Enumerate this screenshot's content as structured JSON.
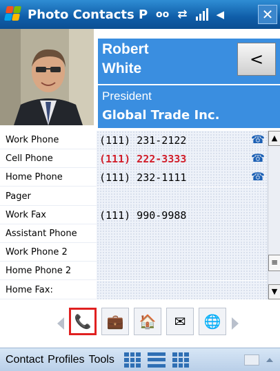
{
  "titlebar": {
    "app_title": "Photo Contacts P",
    "icons": [
      "voicemail-icon",
      "sync-icon",
      "signal-icon",
      "speaker-icon"
    ],
    "voicemail_glyph": "ᴏᴏ",
    "sync_glyph": "⇄",
    "signal_glyph": "📶",
    "speaker_glyph": "◀︎",
    "close_label": "✕"
  },
  "contact": {
    "first_name": "Robert",
    "last_name": "White",
    "job_title": "President",
    "company": "Global Trade Inc.",
    "back_label": "<"
  },
  "fields": [
    {
      "label": "Work Phone",
      "value": "(111) 231-2122",
      "has_phone_icon": true,
      "highlight": false
    },
    {
      "label": "Cell Phone",
      "value": "(111) 222-3333",
      "has_phone_icon": true,
      "highlight": true
    },
    {
      "label": "Home Phone",
      "value": "(111) 232-1111",
      "has_phone_icon": true,
      "highlight": false
    },
    {
      "label": "Pager",
      "value": "",
      "has_phone_icon": false,
      "highlight": false
    },
    {
      "label": "Work Fax",
      "value": "(111) 990-9988",
      "has_phone_icon": false,
      "highlight": false
    },
    {
      "label": "Assistant Phone",
      "value": "",
      "has_phone_icon": false,
      "highlight": false
    },
    {
      "label": "Work Phone 2",
      "value": "",
      "has_phone_icon": false,
      "highlight": false
    },
    {
      "label": "Home Phone 2",
      "value": "",
      "has_phone_icon": false,
      "highlight": false
    },
    {
      "label": "Home Fax:",
      "value": "",
      "has_phone_icon": false,
      "highlight": false
    }
  ],
  "scrollbar": {
    "up_glyph": "▲",
    "down_glyph": "▼",
    "thumb_glyph": "≡"
  },
  "toolbar": {
    "buttons": [
      {
        "name": "phone-profile-icon",
        "glyph": "📞",
        "selected": true
      },
      {
        "name": "briefcase-icon",
        "glyph": "💼",
        "selected": false
      },
      {
        "name": "home-icon",
        "glyph": "🏠",
        "selected": false
      },
      {
        "name": "email-icon",
        "glyph": "✉",
        "selected": false
      },
      {
        "name": "globe-icon",
        "glyph": "🌐",
        "selected": false
      }
    ]
  },
  "menubar": {
    "items": [
      "Contact",
      "Profiles",
      "Tools"
    ],
    "icons": [
      "grid-view-icon",
      "list-view-icon",
      "thumbnail-view-icon",
      "keyboard-icon"
    ]
  },
  "colors": {
    "title_bar": "#0f5da8",
    "header_blue": "#3a8ee0",
    "highlight_red": "#d11e2a",
    "phone_icon": "#1a5fb4"
  }
}
